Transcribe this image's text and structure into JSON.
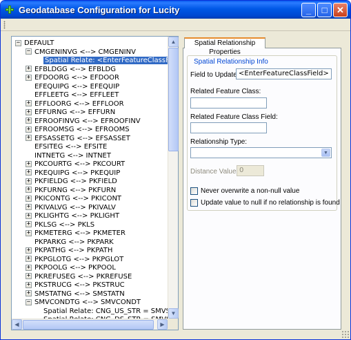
{
  "window": {
    "title": "Geodatabase Configuration for Lucity",
    "minimize_glyph": "_",
    "maximize_glyph": "□",
    "close_glyph": "✕"
  },
  "tree": {
    "expand_glyph": "+",
    "collapse_glyph": "−",
    "nodes": [
      {
        "text": "DEFAULT",
        "state": "collapse",
        "level": 0
      },
      {
        "text": "CMGENINVG <--> CMGENINV",
        "state": "collapse",
        "level": 1
      },
      {
        "text": "Spatial Relate: <EnterFeatureClassField> = ..",
        "state": "leaf",
        "level": 2,
        "selected": true
      },
      {
        "text": "EFBLDGG <--> EFBLDG",
        "state": "expand",
        "level": 1
      },
      {
        "text": "EFDOORG <--> EFDOOR",
        "state": "expand",
        "level": 1
      },
      {
        "text": "EFEQUIPG <--> EFEQUIP",
        "state": "leaf",
        "level": 1
      },
      {
        "text": "EFFLEETG <--> EFFLEET",
        "state": "leaf",
        "level": 1
      },
      {
        "text": "EFFLOORG <--> EFFLOOR",
        "state": "expand",
        "level": 1
      },
      {
        "text": "EFFURNG <--> EFFURN",
        "state": "expand",
        "level": 1
      },
      {
        "text": "EFROOFINVG <--> EFROOFINV",
        "state": "expand",
        "level": 1
      },
      {
        "text": "EFROOMSG <--> EFROOMS",
        "state": "expand",
        "level": 1
      },
      {
        "text": "EFSASSETG <--> EFSASSET",
        "state": "expand",
        "level": 1
      },
      {
        "text": "EFSITEG <--> EFSITE",
        "state": "leaf",
        "level": 1
      },
      {
        "text": "INTNETG <--> INTNET",
        "state": "leaf",
        "level": 1
      },
      {
        "text": "PKCOURTG <--> PKCOURT",
        "state": "expand",
        "level": 1
      },
      {
        "text": "PKEQUIPG <--> PKEQUIP",
        "state": "expand",
        "level": 1
      },
      {
        "text": "PKFIELDG <--> PKFIELD",
        "state": "expand",
        "level": 1
      },
      {
        "text": "PKFURNG <--> PKFURN",
        "state": "expand",
        "level": 1
      },
      {
        "text": "PKICONTG <--> PKICONT",
        "state": "expand",
        "level": 1
      },
      {
        "text": "PKIVALVG <--> PKIVALV",
        "state": "expand",
        "level": 1
      },
      {
        "text": "PKLIGHTG <--> PKLIGHT",
        "state": "expand",
        "level": 1
      },
      {
        "text": "PKLSG <--> PKLS",
        "state": "expand",
        "level": 1
      },
      {
        "text": "PKMETERG <--> PKMETER",
        "state": "expand",
        "level": 1
      },
      {
        "text": "PKPARKG <--> PKPARK",
        "state": "leaf",
        "level": 1
      },
      {
        "text": "PKPATHG <--> PKPATH",
        "state": "expand",
        "level": 1
      },
      {
        "text": "PKPGLOTG <--> PKPGLOT",
        "state": "expand",
        "level": 1
      },
      {
        "text": "PKPOOLG <--> PKPOOL",
        "state": "expand",
        "level": 1
      },
      {
        "text": "PKREFUSEG <--> PKREFUSE",
        "state": "expand",
        "level": 1
      },
      {
        "text": "PKSTRUCG <--> PKSTRUC",
        "state": "expand",
        "level": 1
      },
      {
        "text": "SMSTATNG <--> SMSTATN",
        "state": "expand",
        "level": 1
      },
      {
        "text": "SMVCONDTG <--> SMVCONDT",
        "state": "collapse",
        "level": 1
      },
      {
        "text": "Spatial Relate: CNG_US_STR = SMVSTRUCG.",
        "state": "leaf",
        "level": 2
      },
      {
        "text": "Spatial Relate: CNG_DS_STR = SMVSTRUCG.",
        "state": "leaf",
        "level": 2
      }
    ]
  },
  "tab": {
    "label": "Spatial Relationship Properties"
  },
  "form": {
    "group_title": "Spatial Relationship Info",
    "field_to_update_label": "Field to Update:",
    "field_to_update_value": "<EnterFeatureClassField>",
    "related_class_label": "Related Feature Class:",
    "related_class_value": "",
    "related_field_label": "Related Feature Class Field:",
    "related_field_value": "",
    "relationship_type_label": "Relationship Type:",
    "relationship_type_value": "",
    "distance_label": "Distance Value:",
    "distance_value": "0",
    "never_overwrite_label": "Never overwrite a non-null value",
    "never_overwrite_checked": false,
    "update_null_label": "Update value to null if no relationship is found",
    "update_null_checked": false
  }
}
